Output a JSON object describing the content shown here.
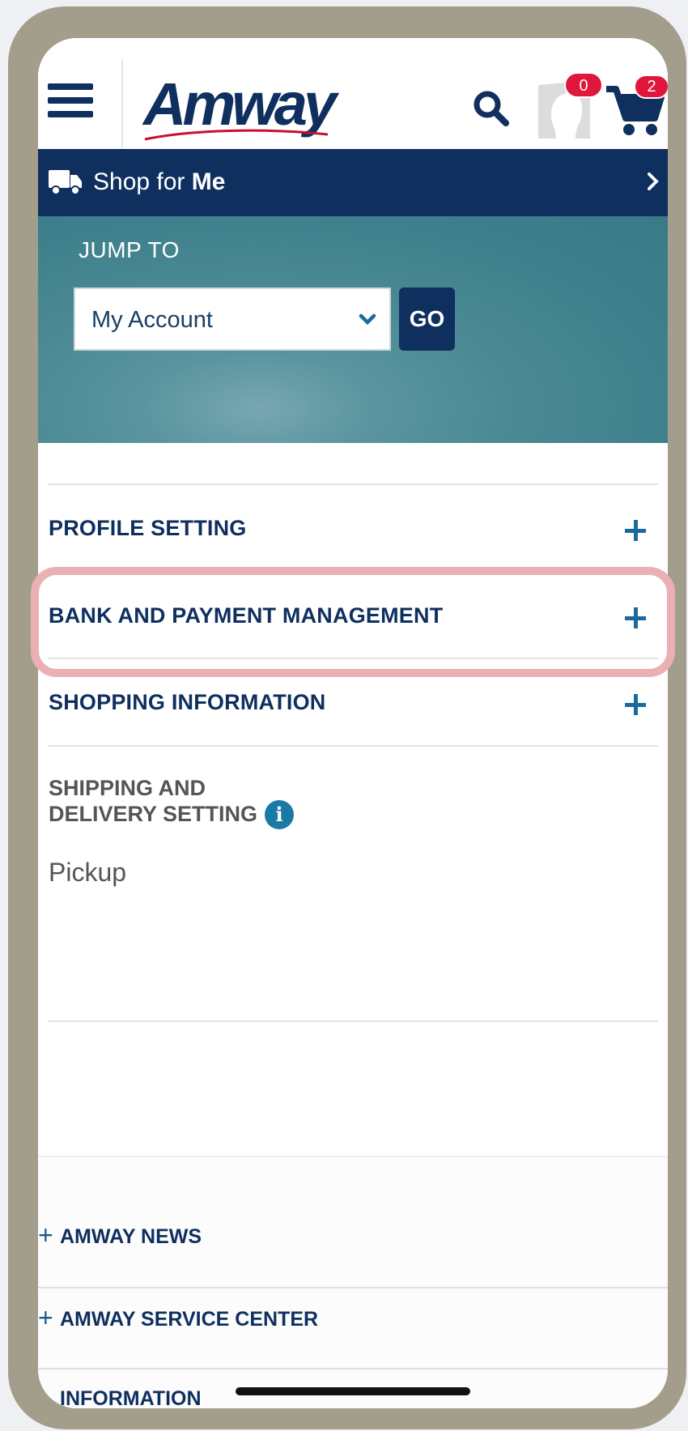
{
  "header": {
    "logo_text": "Amway",
    "avatar_badge": "0",
    "cart_badge": "2"
  },
  "shopbar": {
    "prefix": "Shop for ",
    "target": "Me"
  },
  "jump": {
    "label": "JUMP TO",
    "selected": "My Account",
    "go_label": "GO"
  },
  "sections": [
    {
      "title": "PROFILE SETTING"
    },
    {
      "title": "BANK AND PAYMENT MANAGEMENT"
    },
    {
      "title": "SHOPPING INFORMATION"
    }
  ],
  "shipping": {
    "title_line1": "SHIPPING AND",
    "title_line2": "DELIVERY SETTING",
    "value": "Pickup"
  },
  "footer": {
    "links": [
      "AMWAY NEWS",
      "AMWAY SERVICE CENTER",
      "INFORMATION"
    ]
  },
  "colors": {
    "navy": "#0f2f5f",
    "accent_blue": "#1a6b9a",
    "badge_red": "#e1163c",
    "highlight": "#eab0b4"
  },
  "icons": [
    "menu-icon",
    "search-icon",
    "avatar-icon",
    "cart-icon",
    "truck-icon",
    "chevron-right-icon",
    "chevron-down-icon",
    "plus-icon",
    "info-icon"
  ]
}
